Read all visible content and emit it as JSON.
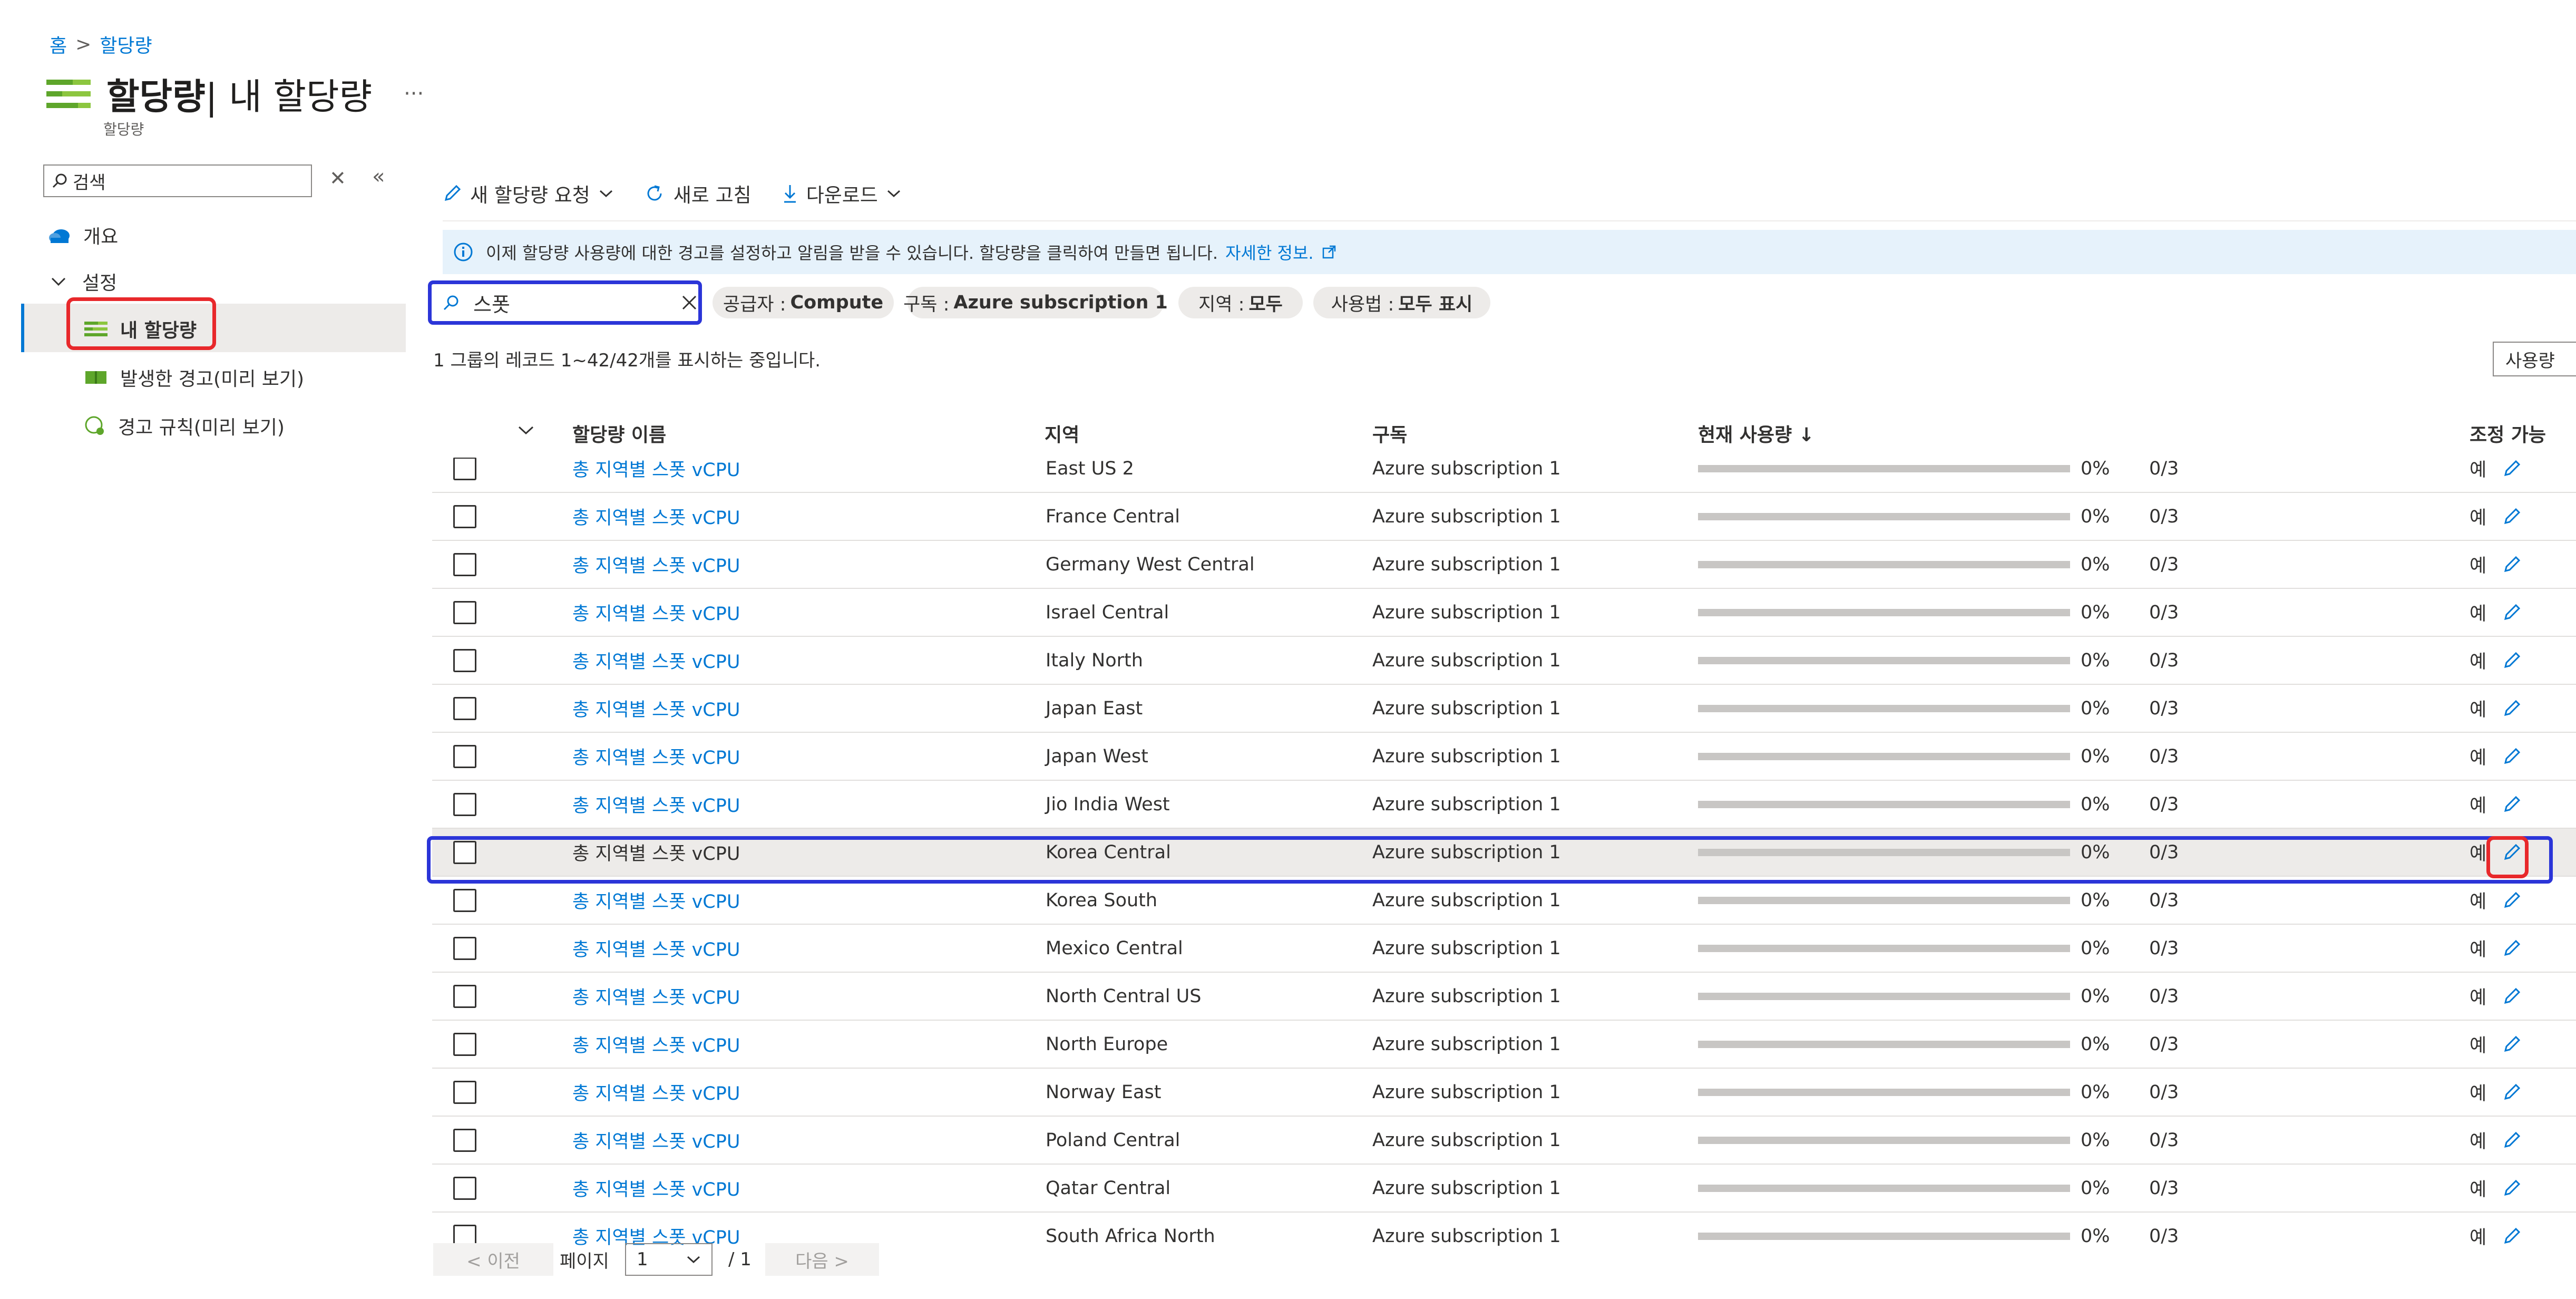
{
  "breadcrumb": {
    "home": "홈",
    "quota": "할당량"
  },
  "header": {
    "title_main": "할당량",
    "title_rest": " | 내 할당량",
    "subtitle": "할당량",
    "more": "···"
  },
  "sidebar": {
    "search_placeholder": "검색",
    "items": [
      {
        "label": "개요",
        "icon": "cloud-icon"
      },
      {
        "label": "설정",
        "icon": "chevron-down-icon"
      },
      {
        "label": "내 할당량",
        "icon": "quota-icon"
      },
      {
        "label": "발생한 경고(미리 보기)",
        "icon": "alert-book-icon"
      },
      {
        "label": "경고 규칙(미리 보기)",
        "icon": "alert-rule-icon"
      }
    ]
  },
  "toolbar": {
    "new_request": "새 할당량 요청",
    "refresh": "새로 고침",
    "download": "다운로드"
  },
  "info": {
    "text": "이제 할당량 사용량에 대한 경고를 설정하고 알림을 받을 수 있습니다. 할당량을 클릭하여 만들면 됩니다.",
    "link": "자세한 정보."
  },
  "filters": {
    "search_value": "스폿",
    "provider": {
      "key": "공급자 : ",
      "value": "Compute"
    },
    "subscription": {
      "key": "구독 : ",
      "value": "Azure subscription 1"
    },
    "region": {
      "key": "지역 : ",
      "value": "모두"
    },
    "usage": {
      "key": "사용법 : ",
      "value": "모두 표시"
    }
  },
  "records_text": "1 그룹의 레코드 1~42/42개를 표시하는 중입니다.",
  "side_button": "사용량",
  "columns": {
    "name": "할당량 이름",
    "region": "지역",
    "subscription": "구독",
    "usage": "현재 사용량 ↓",
    "adjustable": "조정 가능"
  },
  "rows": [
    {
      "name": "총 지역별 스폿 vCPU",
      "region": "East US 2",
      "subscription": "Azure subscription 1",
      "percent": "0%",
      "count": "0/3",
      "adjustable": "예"
    },
    {
      "name": "총 지역별 스폿 vCPU",
      "region": "France Central",
      "subscription": "Azure subscription 1",
      "percent": "0%",
      "count": "0/3",
      "adjustable": "예"
    },
    {
      "name": "총 지역별 스폿 vCPU",
      "region": "Germany West Central",
      "subscription": "Azure subscription 1",
      "percent": "0%",
      "count": "0/3",
      "adjustable": "예"
    },
    {
      "name": "총 지역별 스폿 vCPU",
      "region": "Israel Central",
      "subscription": "Azure subscription 1",
      "percent": "0%",
      "count": "0/3",
      "adjustable": "예"
    },
    {
      "name": "총 지역별 스폿 vCPU",
      "region": "Italy North",
      "subscription": "Azure subscription 1",
      "percent": "0%",
      "count": "0/3",
      "adjustable": "예"
    },
    {
      "name": "총 지역별 스폿 vCPU",
      "region": "Japan East",
      "subscription": "Azure subscription 1",
      "percent": "0%",
      "count": "0/3",
      "adjustable": "예"
    },
    {
      "name": "총 지역별 스폿 vCPU",
      "region": "Japan West",
      "subscription": "Azure subscription 1",
      "percent": "0%",
      "count": "0/3",
      "adjustable": "예"
    },
    {
      "name": "총 지역별 스폿 vCPU",
      "region": "Jio India West",
      "subscription": "Azure subscription 1",
      "percent": "0%",
      "count": "0/3",
      "adjustable": "예"
    },
    {
      "name": "총 지역별 스폿 vCPU",
      "region": "Korea Central",
      "subscription": "Azure subscription 1",
      "percent": "0%",
      "count": "0/3",
      "adjustable": "예",
      "selected": true
    },
    {
      "name": "총 지역별 스폿 vCPU",
      "region": "Korea South",
      "subscription": "Azure subscription 1",
      "percent": "0%",
      "count": "0/3",
      "adjustable": "예"
    },
    {
      "name": "총 지역별 스폿 vCPU",
      "region": "Mexico Central",
      "subscription": "Azure subscription 1",
      "percent": "0%",
      "count": "0/3",
      "adjustable": "예"
    },
    {
      "name": "총 지역별 스폿 vCPU",
      "region": "North Central US",
      "subscription": "Azure subscription 1",
      "percent": "0%",
      "count": "0/3",
      "adjustable": "예"
    },
    {
      "name": "총 지역별 스폿 vCPU",
      "region": "North Europe",
      "subscription": "Azure subscription 1",
      "percent": "0%",
      "count": "0/3",
      "adjustable": "예"
    },
    {
      "name": "총 지역별 스폿 vCPU",
      "region": "Norway East",
      "subscription": "Azure subscription 1",
      "percent": "0%",
      "count": "0/3",
      "adjustable": "예"
    },
    {
      "name": "총 지역별 스폿 vCPU",
      "region": "Poland Central",
      "subscription": "Azure subscription 1",
      "percent": "0%",
      "count": "0/3",
      "adjustable": "예"
    },
    {
      "name": "총 지역별 스폿 vCPU",
      "region": "Qatar Central",
      "subscription": "Azure subscription 1",
      "percent": "0%",
      "count": "0/3",
      "adjustable": "예"
    },
    {
      "name": "총 지역별 스폿 vCPU",
      "region": "South Africa North",
      "subscription": "Azure subscription 1",
      "percent": "0%",
      "count": "0/3",
      "adjustable": "예"
    }
  ],
  "pager": {
    "prev": "< 이전",
    "page_label": "페이지",
    "page_value": "1",
    "total": "/ 1",
    "next": "다음 >"
  },
  "colors": {
    "accent": "#0078d4",
    "highlight_red": "#e8282b",
    "highlight_blue": "#2b35d8",
    "selected_row": "#edebe9"
  }
}
